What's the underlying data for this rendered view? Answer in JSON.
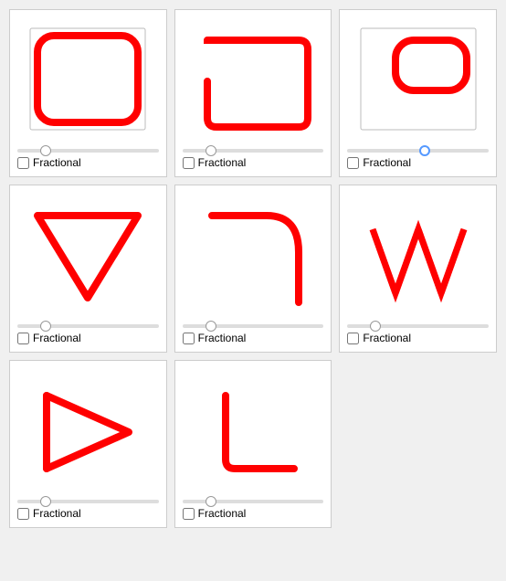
{
  "cards": [
    {
      "id": "rounded-rect-full",
      "label": "Fractional",
      "sliderPos": "20%",
      "thumbBlue": false
    },
    {
      "id": "rounded-rect-partial",
      "label": "Fractional",
      "sliderPos": "20%",
      "thumbBlue": false
    },
    {
      "id": "rounded-rect-small",
      "label": "Fractional",
      "sliderPos": "55%",
      "thumbBlue": true
    },
    {
      "id": "triangle",
      "label": "Fractional",
      "sliderPos": "20%",
      "thumbBlue": false
    },
    {
      "id": "curve",
      "label": "Fractional",
      "sliderPos": "20%",
      "thumbBlue": false
    },
    {
      "id": "zigzag",
      "label": "Fractional",
      "sliderPos": "20%",
      "thumbBlue": false
    },
    {
      "id": "arrow",
      "label": "Fractional",
      "sliderPos": "20%",
      "thumbBlue": false
    },
    {
      "id": "corner",
      "label": "Fractional",
      "sliderPos": "20%",
      "thumbBlue": false
    }
  ]
}
